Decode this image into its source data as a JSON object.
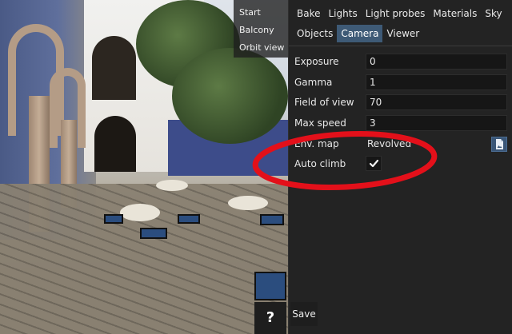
{
  "camera_list": {
    "items": [
      "Start",
      "Balcony",
      "Orbit view"
    ]
  },
  "tabs": {
    "row1": [
      "Bake",
      "Lights",
      "Light probes",
      "Materials",
      "Sky"
    ],
    "row2": [
      "Objects",
      "Camera",
      "Viewer"
    ],
    "active": "Camera"
  },
  "properties": {
    "exposure": {
      "label": "Exposure",
      "value": "0"
    },
    "gamma": {
      "label": "Gamma",
      "value": "1"
    },
    "fov": {
      "label": "Field of view",
      "value": "70"
    },
    "max_speed": {
      "label": "Max speed",
      "value": "3"
    },
    "env_map": {
      "label": "Env. map",
      "value": "Revolved"
    },
    "auto_climb": {
      "label": "Auto climb",
      "checked": true
    }
  },
  "help_label": "?",
  "save_label": "Save",
  "colors": {
    "accent_tab": "#3e5a76",
    "annotation": "#e3101a",
    "panel_bg": "#232323"
  }
}
